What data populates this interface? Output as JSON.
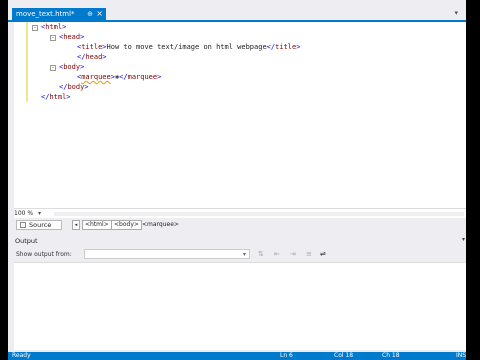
{
  "tab": {
    "filename": "move_text.html*",
    "pin": "⊕",
    "close": "×",
    "strip_menu": "▾"
  },
  "code": {
    "line1": {
      "open": "<",
      "tag": "html",
      "close": ">"
    },
    "line2": {
      "open": "<",
      "tag": "head",
      "close": ">"
    },
    "line3": {
      "open": "<",
      "tag": "title",
      "close": ">",
      "text": "How to move text/image on html webpage",
      "end_open": "</",
      "end_tag": "title",
      "end_close": ">"
    },
    "line4": {
      "open": "</",
      "tag": "head",
      "close": ">"
    },
    "line5": {
      "open": "<",
      "tag": "body",
      "close": ">"
    },
    "line6": {
      "open": "<",
      "tag": "marquee",
      "close": ">",
      "end_open": "</",
      "end_tag": "marquee",
      "end_close": ">"
    },
    "line7": {
      "open": "</",
      "tag": "body",
      "close": ">"
    },
    "line8": {
      "open": "</",
      "tag": "html",
      "close": ">"
    }
  },
  "zoom": {
    "level": "100 %",
    "arrow": "▾"
  },
  "view": {
    "source_label": "Source",
    "back": "◂",
    "crumbs": [
      "<html>",
      "<body>",
      "<marquee>"
    ]
  },
  "output": {
    "title": "Output",
    "menu": "▾",
    "show_label": "Show output from:",
    "select_value": "",
    "select_arrow": "▾"
  },
  "status": {
    "ready": "Ready",
    "ln": "Ln 6",
    "col": "Col 18",
    "ch": "Ch 18",
    "ins": "INS"
  }
}
